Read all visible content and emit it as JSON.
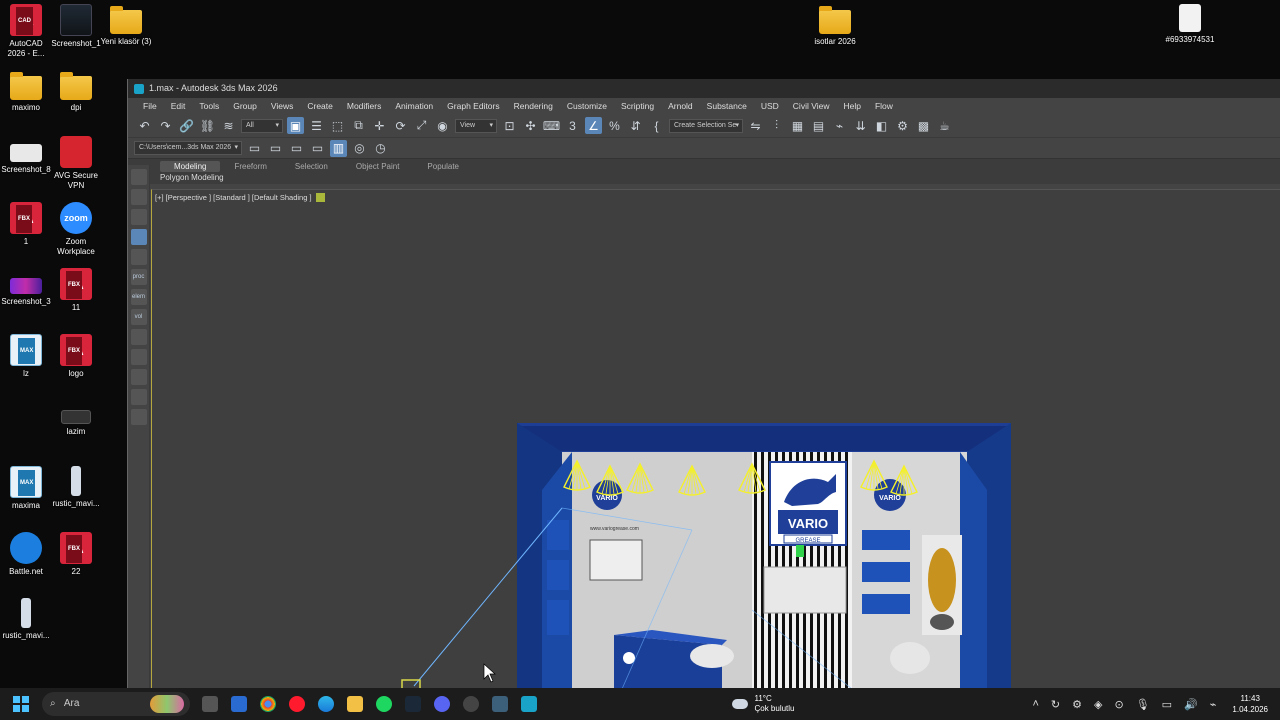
{
  "desktop": {
    "icons": [
      {
        "label": "AutoCAD 2026 - E...",
        "type": "acad"
      },
      {
        "label": "Screenshot_1",
        "type": "dark"
      },
      {
        "label": "Yeni klasör (3)",
        "type": "folder"
      },
      {
        "label": "isotlar 2026",
        "type": "folder"
      },
      {
        "label": "#6933974531",
        "type": "paper"
      },
      {
        "label": "maximo",
        "type": "folder"
      },
      {
        "label": "dpi",
        "type": "folder"
      },
      {
        "label": "Screenshot_8",
        "type": "light"
      },
      {
        "label": "AVG Secure VPN",
        "type": "vpn"
      },
      {
        "label": "1",
        "type": "fbx"
      },
      {
        "label": "Zoom Workplace",
        "type": "zoom"
      },
      {
        "label": "Screenshot_3",
        "type": "purple"
      },
      {
        "label": "11",
        "type": "fbx"
      },
      {
        "label": "lz",
        "type": "max"
      },
      {
        "label": "logo",
        "type": "fbx"
      },
      {
        "label": "lazim",
        "type": "small"
      },
      {
        "label": "maxima",
        "type": "max"
      },
      {
        "label": "rustic_mavi...",
        "type": "slim"
      },
      {
        "label": "Battle.net",
        "type": "battle"
      },
      {
        "label": "22",
        "type": "fbx"
      },
      {
        "label": "rustic_mavi...",
        "type": "slim"
      }
    ],
    "zoom_text": "zoom"
  },
  "window": {
    "title": "1.max - Autodesk 3ds Max 2026",
    "menu": [
      "File",
      "Edit",
      "Tools",
      "Group",
      "Views",
      "Create",
      "Modifiers",
      "Animation",
      "Graph Editors",
      "Rendering",
      "Customize",
      "Scripting",
      "Arnold",
      "Substance",
      "USD",
      "Civil View",
      "Help",
      "Flow"
    ],
    "filter_value": "All",
    "view_value": "View",
    "selection_set_placeholder": "Create Selection Se",
    "project_path": "C:\\Users\\cem...3ds Max 2026",
    "ribbon_tabs": [
      "Modeling",
      "Freeform",
      "Selection",
      "Object Paint",
      "Populate"
    ],
    "ribbon_sub": "Polygon Modeling",
    "viewport_label": "[+] [Perspective ] [Standard ] [Default Shading ]",
    "left_tools": [
      "proc",
      "elem",
      "vol"
    ]
  },
  "scene": {
    "brand": "VARIO",
    "brand_sub": "GREASE",
    "website": "www.variogrease.com"
  },
  "taskbar": {
    "search_placeholder": "Ara",
    "weather_temp": "11°C",
    "weather_desc": "Çok bulutlu",
    "time": "11:43",
    "date": "1.04.2026"
  }
}
